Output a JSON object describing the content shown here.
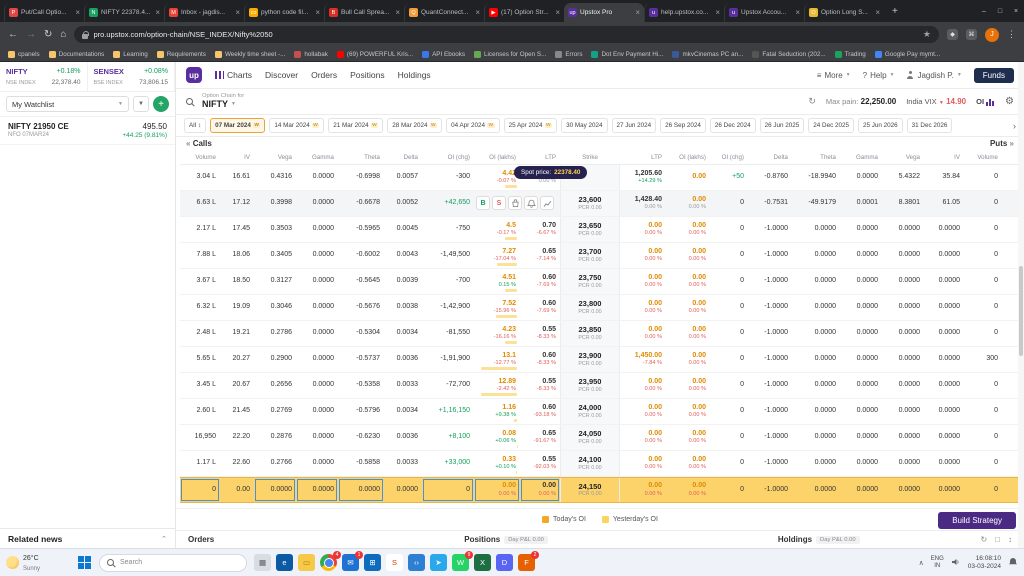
{
  "browser": {
    "window_controls": {
      "min": "–",
      "max": "□",
      "close": "×"
    },
    "new_tab": "+",
    "tabs": [
      {
        "title": "Put/Call Optio...",
        "fav": "#e04646",
        "fi": "P",
        "cls": ""
      },
      {
        "title": "NIFTY 22378.4...",
        "fav": "#1aa260",
        "fi": "N",
        "cls": ""
      },
      {
        "title": "Inbox - jagdis...",
        "fav": "#ea4335",
        "fi": "M",
        "cls": ""
      },
      {
        "title": "python code fil...",
        "fav": "#f9ab00",
        "fi": "co",
        "cls": ""
      },
      {
        "title": "Bull Call Sprea...",
        "fav": "#d93025",
        "fi": "B",
        "cls": ""
      },
      {
        "title": "QuantConnect...",
        "fav": "#f29d38",
        "fi": "Q",
        "cls": ""
      },
      {
        "title": "(17) Option Str...",
        "fav": "#ff0000",
        "fi": "▶",
        "cls": ""
      },
      {
        "title": "Upstox Pro",
        "fav": "#5a2e9e",
        "fi": "up",
        "cls": "active"
      },
      {
        "title": "help.upstox.co...",
        "fav": "#5a2e9e",
        "fi": "u",
        "cls": ""
      },
      {
        "title": "Upstox Accou...",
        "fav": "#5a2e9e",
        "fi": "u",
        "cls": ""
      },
      {
        "title": "Option Long S...",
        "fav": "#e8b931",
        "fi": "O",
        "cls": ""
      }
    ],
    "nav": {
      "back": "←",
      "forward": "→",
      "reload": "↻",
      "home": "⌂"
    },
    "url": "pro.upstox.com/option-chain/NSE_INDEX/Nifty%2050",
    "star": "★",
    "menu": "⋮",
    "profile_initial": "J"
  },
  "bookmarks": [
    {
      "label": "cpanels",
      "color": "#f7c56a"
    },
    {
      "label": "Documentations",
      "color": "#f7c56a"
    },
    {
      "label": "Learning",
      "color": "#f7c56a"
    },
    {
      "label": "Requirements",
      "color": "#f7c56a"
    },
    {
      "label": "Weekly time sheet -...",
      "color": "#f7c56a"
    },
    {
      "label": "hollabak",
      "color": "#c34f4f"
    },
    {
      "label": "(69) POWERFUL Kris...",
      "color": "#ff0000"
    },
    {
      "label": "API Ebooks",
      "color": "#3b78e7"
    },
    {
      "label": "Licenses for Open S...",
      "color": "#6aa84f"
    },
    {
      "label": "Errors",
      "color": "#888888"
    },
    {
      "label": "Dot Env Payment Hi...",
      "color": "#16a085"
    },
    {
      "label": "mkvCinemas PC an...",
      "color": "#3b5998"
    },
    {
      "label": "Fatal Seduction (202...",
      "color": "#555555"
    },
    {
      "label": "Trading",
      "color": "#1aa260"
    },
    {
      "label": "Google Pay mymt...",
      "color": "#4285f4"
    }
  ],
  "sidebar": {
    "indices": [
      {
        "name": "NIFTY",
        "exch": "NSE INDEX",
        "chg": "+0.18%",
        "value": "22,378.40"
      },
      {
        "name": "SENSEX",
        "exch": "BSE INDEX",
        "chg": "+0.08%",
        "value": "73,806.15"
      }
    ],
    "watchlist_label": "My Watchlist",
    "item": {
      "name": "NIFTY 21950 CE",
      "meta": "NFO 07MAR24",
      "price": "495.50",
      "change": "+44.25 (9.81%)"
    },
    "related_news": "Related news"
  },
  "header": {
    "logo": "up",
    "nav": [
      {
        "label": "Charts"
      },
      {
        "label": "Discover"
      },
      {
        "label": "Orders"
      },
      {
        "label": "Positions"
      },
      {
        "label": "Holdings"
      }
    ],
    "more": "More",
    "help": "Help",
    "user": "Jagdish P.",
    "funds": "Funds"
  },
  "chain": {
    "label": "Option Chain for",
    "symbol": "NIFTY",
    "max_pain_label": "Max pain:",
    "max_pain_value": "22,250.00",
    "vix_label": "India VIX",
    "vix_value": "14.90",
    "oi_toggle": "OI"
  },
  "dates": {
    "all": "All",
    "chev": "›",
    "items": [
      {
        "label": "07 Mar 2024",
        "w": "W",
        "cls": "sel"
      },
      {
        "label": "14 Mar 2024",
        "w": "W",
        "cls": ""
      },
      {
        "label": "21 Mar 2024",
        "w": "W",
        "cls": ""
      },
      {
        "label": "28 Mar 2024",
        "w": "W",
        "cls": ""
      },
      {
        "label": "04 Apr 2024",
        "w": "W",
        "cls": ""
      },
      {
        "label": "25 Apr 2024",
        "w": "W",
        "cls": ""
      },
      {
        "label": "30 May 2024",
        "w": "",
        "cls": ""
      },
      {
        "label": "27 Jun 2024",
        "w": "",
        "cls": ""
      },
      {
        "label": "26 Sep 2024",
        "w": "",
        "cls": ""
      },
      {
        "label": "26 Dec 2024",
        "w": "",
        "cls": ""
      },
      {
        "label": "26 Jun 2025",
        "w": "",
        "cls": ""
      },
      {
        "label": "24 Dec 2025",
        "w": "",
        "cls": ""
      },
      {
        "label": "25 Jun 2026",
        "w": "",
        "cls": ""
      },
      {
        "label": "31 Dec 2026",
        "w": "",
        "cls": ""
      }
    ]
  },
  "table": {
    "calls_label": "Calls",
    "puts_label": "Puts",
    "arrow_left": "«",
    "arrow_right": "»",
    "headers_left": [
      "Volume",
      "IV",
      "Vega",
      "Gamma",
      "Theta",
      "Delta",
      "OI (chg)",
      "OI (lakhs)",
      "LTP"
    ],
    "strike_header": "Strike",
    "headers_right": [
      "LTP",
      "OI (lakhs)",
      "OI (chg)",
      "Delta",
      "Theta",
      "Gamma",
      "Vega",
      "IV",
      "Volume"
    ],
    "spot": {
      "label": "Spot price:",
      "value": "22378.40"
    },
    "actions": {
      "buy": "B",
      "sell": "S"
    },
    "rows": [
      {
        "cls": "",
        "c_vol": "3.04 L",
        "c_iv": "16.61",
        "c_vega": "0.4316",
        "c_gamma": "0.0000",
        "c_theta": "-0.6998",
        "c_delta": "0.0057",
        "c_oichg": "-300",
        "oc_cls": "",
        "c_oi": "4.42",
        "c_oip": "-0.07 %",
        "c_oip_cls": "neg",
        "c_ltp": "0.85",
        "c_ltpp": "0.00 %",
        "c_ltpp_cls": "neu",
        "strike": "",
        "pcr": "",
        "p_ltp": "1,205.60",
        "p_ltp_cls": "",
        "p_ltpp": "+14.29 %",
        "p_ltpp_cls": "pos",
        "p_oi": "0.00",
        "p_oip": "",
        "p_oip_cls": "neu",
        "p_oichg": "+50",
        "poc_cls": "pos",
        "p_delta": "-0.8760",
        "p_theta": "-18.9940",
        "p_gamma": "0.0000",
        "p_vega": "5.4322",
        "p_iv": "35.84",
        "p_vol": "0"
      },
      {
        "cls": "hover",
        "c_vol": "6.63 L",
        "c_iv": "17.12",
        "c_vega": "0.3998",
        "c_gamma": "0.0000",
        "c_theta": "-0.6678",
        "c_delta": "0.0052",
        "c_oichg": "+42,650",
        "oc_cls": "pos",
        "c_oi": "",
        "c_oip": "",
        "c_oip_cls": "",
        "c_ltp": "",
        "c_ltpp": "",
        "c_ltpp_cls": "",
        "strike": "23,600",
        "pcr": "PCR 0.00",
        "p_ltp": "1,428.40",
        "p_ltp_cls": "",
        "p_ltpp": "0.00 %",
        "p_ltpp_cls": "neu",
        "p_oi": "0.00",
        "p_oip": "0.00 %",
        "p_oip_cls": "neu",
        "p_oichg": "0",
        "poc_cls": "",
        "p_delta": "-0.7531",
        "p_theta": "-49.9179",
        "p_gamma": "0.0001",
        "p_vega": "8.3801",
        "p_iv": "61.05",
        "p_vol": "0"
      },
      {
        "cls": "",
        "c_vol": "2.17 L",
        "c_iv": "17.45",
        "c_vega": "0.3503",
        "c_gamma": "0.0000",
        "c_theta": "-0.5965",
        "c_delta": "0.0045",
        "c_oichg": "-750",
        "oc_cls": "",
        "c_oi": "4.5",
        "c_oip": "-0.17 %",
        "c_oip_cls": "neg",
        "c_ltp": "0.70",
        "c_ltpp": "-6.67 %",
        "c_ltpp_cls": "neg",
        "strike": "23,650",
        "pcr": "PCR 0.00",
        "p_ltp": "0.00",
        "p_ltp_cls": "org",
        "p_ltpp": "0.00 %",
        "p_ltpp_cls": "neg",
        "p_oi": "0.00",
        "p_oip": "0.00 %",
        "p_oip_cls": "neg",
        "p_oichg": "0",
        "poc_cls": "",
        "p_delta": "-1.0000",
        "p_theta": "0.0000",
        "p_gamma": "0.0000",
        "p_vega": "0.0000",
        "p_iv": "0.0000",
        "p_vol": "0"
      },
      {
        "cls": "",
        "c_vol": "7.88 L",
        "c_iv": "18.06",
        "c_vega": "0.3405",
        "c_gamma": "0.0000",
        "c_theta": "-0.6002",
        "c_delta": "0.0043",
        "c_oichg": "-1,49,500",
        "oc_cls": "",
        "c_oi": "7.27",
        "c_oip": "-17.04 %",
        "c_oip_cls": "neg",
        "c_ltp": "0.65",
        "c_ltpp": "-7.14 %",
        "c_ltpp_cls": "neg",
        "strike": "23,700",
        "pcr": "PCR 0.00",
        "p_ltp": "0.00",
        "p_ltp_cls": "org",
        "p_ltpp": "0.00 %",
        "p_ltpp_cls": "neg",
        "p_oi": "0.00",
        "p_oip": "0.00 %",
        "p_oip_cls": "neg",
        "p_oichg": "0",
        "poc_cls": "",
        "p_delta": "-1.0000",
        "p_theta": "0.0000",
        "p_gamma": "0.0000",
        "p_vega": "0.0000",
        "p_iv": "0.0000",
        "p_vol": "0"
      },
      {
        "cls": "",
        "c_vol": "3.67 L",
        "c_iv": "18.50",
        "c_vega": "0.3127",
        "c_gamma": "0.0000",
        "c_theta": "-0.5645",
        "c_delta": "0.0039",
        "c_oichg": "-700",
        "oc_cls": "",
        "c_oi": "4.51",
        "c_oip": "0.15 %",
        "c_oip_cls": "pos",
        "c_ltp": "0.60",
        "c_ltpp": "-7.69 %",
        "c_ltpp_cls": "neg",
        "strike": "23,750",
        "pcr": "PCR 0.00",
        "p_ltp": "0.00",
        "p_ltp_cls": "org",
        "p_ltpp": "0.00 %",
        "p_ltpp_cls": "neg",
        "p_oi": "0.00",
        "p_oip": "0.00 %",
        "p_oip_cls": "neg",
        "p_oichg": "0",
        "poc_cls": "",
        "p_delta": "-1.0000",
        "p_theta": "0.0000",
        "p_gamma": "0.0000",
        "p_vega": "0.0000",
        "p_iv": "0.0000",
        "p_vol": "0"
      },
      {
        "cls": "",
        "c_vol": "6.32 L",
        "c_iv": "19.09",
        "c_vega": "0.3046",
        "c_gamma": "0.0000",
        "c_theta": "-0.5676",
        "c_delta": "0.0038",
        "c_oichg": "-1,42,900",
        "oc_cls": "",
        "c_oi": "7.52",
        "c_oip": "-15.96 %",
        "c_oip_cls": "neg",
        "c_ltp": "0.60",
        "c_ltpp": "-7.69 %",
        "c_ltpp_cls": "neg",
        "strike": "23,800",
        "pcr": "PCR 0.00",
        "p_ltp": "0.00",
        "p_ltp_cls": "org",
        "p_ltpp": "0.00 %",
        "p_ltpp_cls": "neg",
        "p_oi": "0.00",
        "p_oip": "0.00 %",
        "p_oip_cls": "neg",
        "p_oichg": "0",
        "poc_cls": "",
        "p_delta": "-1.0000",
        "p_theta": "0.0000",
        "p_gamma": "0.0000",
        "p_vega": "0.0000",
        "p_iv": "0.0000",
        "p_vol": "0"
      },
      {
        "cls": "",
        "c_vol": "2.48 L",
        "c_iv": "19.21",
        "c_vega": "0.2786",
        "c_gamma": "0.0000",
        "c_theta": "-0.5304",
        "c_delta": "0.0034",
        "c_oichg": "-81,550",
        "oc_cls": "",
        "c_oi": "4.23",
        "c_oip": "-16.16 %",
        "c_oip_cls": "neg",
        "c_ltp": "0.55",
        "c_ltpp": "-8.33 %",
        "c_ltpp_cls": "neg",
        "strike": "23,850",
        "pcr": "PCR 0.00",
        "p_ltp": "0.00",
        "p_ltp_cls": "org",
        "p_ltpp": "0.00 %",
        "p_ltpp_cls": "neg",
        "p_oi": "0.00",
        "p_oip": "0.00 %",
        "p_oip_cls": "neg",
        "p_oichg": "0",
        "poc_cls": "",
        "p_delta": "-1.0000",
        "p_theta": "0.0000",
        "p_gamma": "0.0000",
        "p_vega": "0.0000",
        "p_iv": "0.0000",
        "p_vol": "0"
      },
      {
        "cls": "",
        "c_vol": "5.65 L",
        "c_iv": "20.27",
        "c_vega": "0.2900",
        "c_gamma": "0.0000",
        "c_theta": "-0.5737",
        "c_delta": "0.0036",
        "c_oichg": "-1,91,900",
        "oc_cls": "",
        "c_oi": "13.1",
        "c_oip": "-12.77 %",
        "c_oip_cls": "neg",
        "c_ltp": "0.60",
        "c_ltpp": "-8.33 %",
        "c_ltpp_cls": "neg",
        "strike": "23,900",
        "pcr": "PCR 0.00",
        "p_ltp": "1,450.00",
        "p_ltp_cls": "org",
        "p_ltpp": "-7.84 %",
        "p_ltpp_cls": "neg",
        "p_oi": "0.00",
        "p_oip": "0.00 %",
        "p_oip_cls": "neg",
        "p_oichg": "0",
        "poc_cls": "",
        "p_delta": "-1.0000",
        "p_theta": "0.0000",
        "p_gamma": "0.0000",
        "p_vega": "0.0000",
        "p_iv": "0.0000",
        "p_vol": "300"
      },
      {
        "cls": "",
        "c_vol": "3.45 L",
        "c_iv": "20.67",
        "c_vega": "0.2656",
        "c_gamma": "0.0000",
        "c_theta": "-0.5358",
        "c_delta": "0.0033",
        "c_oichg": "-72,700",
        "oc_cls": "",
        "c_oi": "12.89",
        "c_oip": "-2.42 %",
        "c_oip_cls": "neg",
        "c_ltp": "0.55",
        "c_ltpp": "-8.33 %",
        "c_ltpp_cls": "neg",
        "strike": "23,950",
        "pcr": "PCR 0.00",
        "p_ltp": "0.00",
        "p_ltp_cls": "org",
        "p_ltpp": "0.00 %",
        "p_ltpp_cls": "neg",
        "p_oi": "0.00",
        "p_oip": "0.00 %",
        "p_oip_cls": "neg",
        "p_oichg": "0",
        "poc_cls": "",
        "p_delta": "-1.0000",
        "p_theta": "0.0000",
        "p_gamma": "0.0000",
        "p_vega": "0.0000",
        "p_iv": "0.0000",
        "p_vol": "0"
      },
      {
        "cls": "",
        "c_vol": "2.60 L",
        "c_iv": "21.45",
        "c_vega": "0.2769",
        "c_gamma": "0.0000",
        "c_theta": "-0.5796",
        "c_delta": "0.0034",
        "c_oichg": "+1,16,150",
        "oc_cls": "pos",
        "c_oi": "1.16",
        "c_oip": "+9.38 %",
        "c_oip_cls": "pos",
        "c_ltp": "0.60",
        "c_ltpp": "-93.18 %",
        "c_ltpp_cls": "neg",
        "strike": "24,000",
        "pcr": "PCR 0.00",
        "p_ltp": "0.00",
        "p_ltp_cls": "org",
        "p_ltpp": "0.00 %",
        "p_ltpp_cls": "neg",
        "p_oi": "0.00",
        "p_oip": "0.00 %",
        "p_oip_cls": "neg",
        "p_oichg": "0",
        "poc_cls": "",
        "p_delta": "-1.0000",
        "p_theta": "0.0000",
        "p_gamma": "0.0000",
        "p_vega": "0.0000",
        "p_iv": "0.0000",
        "p_vol": "0"
      },
      {
        "cls": "",
        "c_vol": "16,950",
        "c_iv": "22.20",
        "c_vega": "0.2876",
        "c_gamma": "0.0000",
        "c_theta": "-0.6230",
        "c_delta": "0.0036",
        "c_oichg": "+8,100",
        "oc_cls": "pos",
        "c_oi": "0.08",
        "c_oip": "+0.06 %",
        "c_oip_cls": "pos",
        "c_ltp": "0.65",
        "c_ltpp": "-91.67 %",
        "c_ltpp_cls": "neg",
        "strike": "24,050",
        "pcr": "PCR 0.00",
        "p_ltp": "0.00",
        "p_ltp_cls": "org",
        "p_ltpp": "0.00 %",
        "p_ltpp_cls": "neg",
        "p_oi": "0.00",
        "p_oip": "0.00 %",
        "p_oip_cls": "neg",
        "p_oichg": "0",
        "poc_cls": "",
        "p_delta": "-1.0000",
        "p_theta": "0.0000",
        "p_gamma": "0.0000",
        "p_vega": "0.0000",
        "p_iv": "0.0000",
        "p_vol": "0"
      },
      {
        "cls": "",
        "c_vol": "1.17 L",
        "c_iv": "22.60",
        "c_vega": "0.2766",
        "c_gamma": "0.0000",
        "c_theta": "-0.5858",
        "c_delta": "0.0033",
        "c_oichg": "+33,000",
        "oc_cls": "pos",
        "c_oi": "0.33",
        "c_oip": "+0.10 %",
        "c_oip_cls": "pos",
        "c_ltp": "0.55",
        "c_ltpp": "-92.03 %",
        "c_ltpp_cls": "neg",
        "strike": "24,100",
        "pcr": "PCR 0.00",
        "p_ltp": "0.00",
        "p_ltp_cls": "org",
        "p_ltpp": "0.00 %",
        "p_ltpp_cls": "neg",
        "p_oi": "0.00",
        "p_oip": "0.00 %",
        "p_oip_cls": "neg",
        "p_oichg": "0",
        "poc_cls": "",
        "p_delta": "-1.0000",
        "p_theta": "0.0000",
        "p_gamma": "0.0000",
        "p_vega": "0.0000",
        "p_iv": "0.0000",
        "p_vol": "0"
      },
      {
        "cls": "sel",
        "c_vol": "0",
        "c_iv": "0.00",
        "c_vega": "0.0000",
        "c_gamma": "0.0000",
        "c_theta": "0.0000",
        "c_delta": "0.0000",
        "c_oichg": "0",
        "oc_cls": "",
        "c_oi": "0.00",
        "c_oip": "0.00 %",
        "c_oip_cls": "neg",
        "c_ltp": "0.00",
        "c_ltpp": "0.00 %",
        "c_ltpp_cls": "neg",
        "strike": "24,150",
        "pcr": "PCR 0.00",
        "p_ltp": "0.00",
        "p_ltp_cls": "org",
        "p_ltpp": "0.00 %",
        "p_ltpp_cls": "neg",
        "p_oi": "0.00",
        "p_oip": "0.00 %",
        "p_oip_cls": "neg",
        "p_oichg": "0",
        "poc_cls": "",
        "p_delta": "-1.0000",
        "p_theta": "0.0000",
        "p_gamma": "0.0000",
        "p_vega": "0.0000",
        "p_iv": "0.0000",
        "p_vol": "0"
      }
    ],
    "legend": [
      {
        "label": "Today's OI",
        "color": "#f5a623"
      },
      {
        "label": "Yesterday's OI",
        "color": "#fad45c"
      }
    ],
    "build_strategy": "Build Strategy"
  },
  "footer": {
    "orders": "Orders",
    "positions": "Positions",
    "positions_badge": "Day P&L 0.00",
    "holdings": "Holdings",
    "holdings_badge": "Day P&L 0.00"
  },
  "taskbar": {
    "weather_temp": "26°C",
    "weather_desc": "Sunny",
    "search_placeholder": "Search",
    "apps": [
      {
        "bg": "#d8dde3",
        "fg": "#555555",
        "glyph": "▦",
        "badge": "",
        "ring": ""
      },
      {
        "bg": "#0c59a4",
        "fg": "#ffffff",
        "glyph": "e",
        "badge": "",
        "ring": ""
      },
      {
        "bg": "#f7c948",
        "fg": "#a97b00",
        "glyph": "▭",
        "badge": "",
        "ring": ""
      },
      {
        "bg": "",
        "fg": "#ffffff",
        "glyph": "",
        "badge": "4",
        "ring": "ring"
      },
      {
        "bg": "#1e73d2",
        "fg": "#ffffff",
        "glyph": "✉",
        "badge": "1",
        "ring": ""
      },
      {
        "bg": "#0f6cbd",
        "fg": "#ffffff",
        "glyph": "⊞",
        "badge": "",
        "ring": ""
      },
      {
        "bg": "#ffffff",
        "fg": "#d83b01",
        "glyph": "S",
        "badge": "",
        "ring": ""
      },
      {
        "bg": "#2d7fd3",
        "fg": "#ffffff",
        "glyph": "‹›",
        "badge": "",
        "ring": ""
      },
      {
        "bg": "#29a9eb",
        "fg": "#ffffff",
        "glyph": "➤",
        "badge": "",
        "ring": ""
      },
      {
        "bg": "#25d366",
        "fg": "#ffffff",
        "glyph": "W",
        "badge": "9",
        "ring": ""
      },
      {
        "bg": "#1d6f42",
        "fg": "#ffffff",
        "glyph": "X",
        "badge": "",
        "ring": ""
      },
      {
        "bg": "#5865f2",
        "fg": "#ffffff",
        "glyph": "D",
        "badge": "",
        "ring": ""
      },
      {
        "bg": "#e66000",
        "fg": "#ffffff",
        "glyph": "F",
        "badge": "2",
        "ring": ""
      }
    ],
    "tray": {
      "expand": "∧",
      "lang1": "ENG",
      "lang2": "IN",
      "time": "16:08:10",
      "date": "03-03-2024"
    }
  }
}
